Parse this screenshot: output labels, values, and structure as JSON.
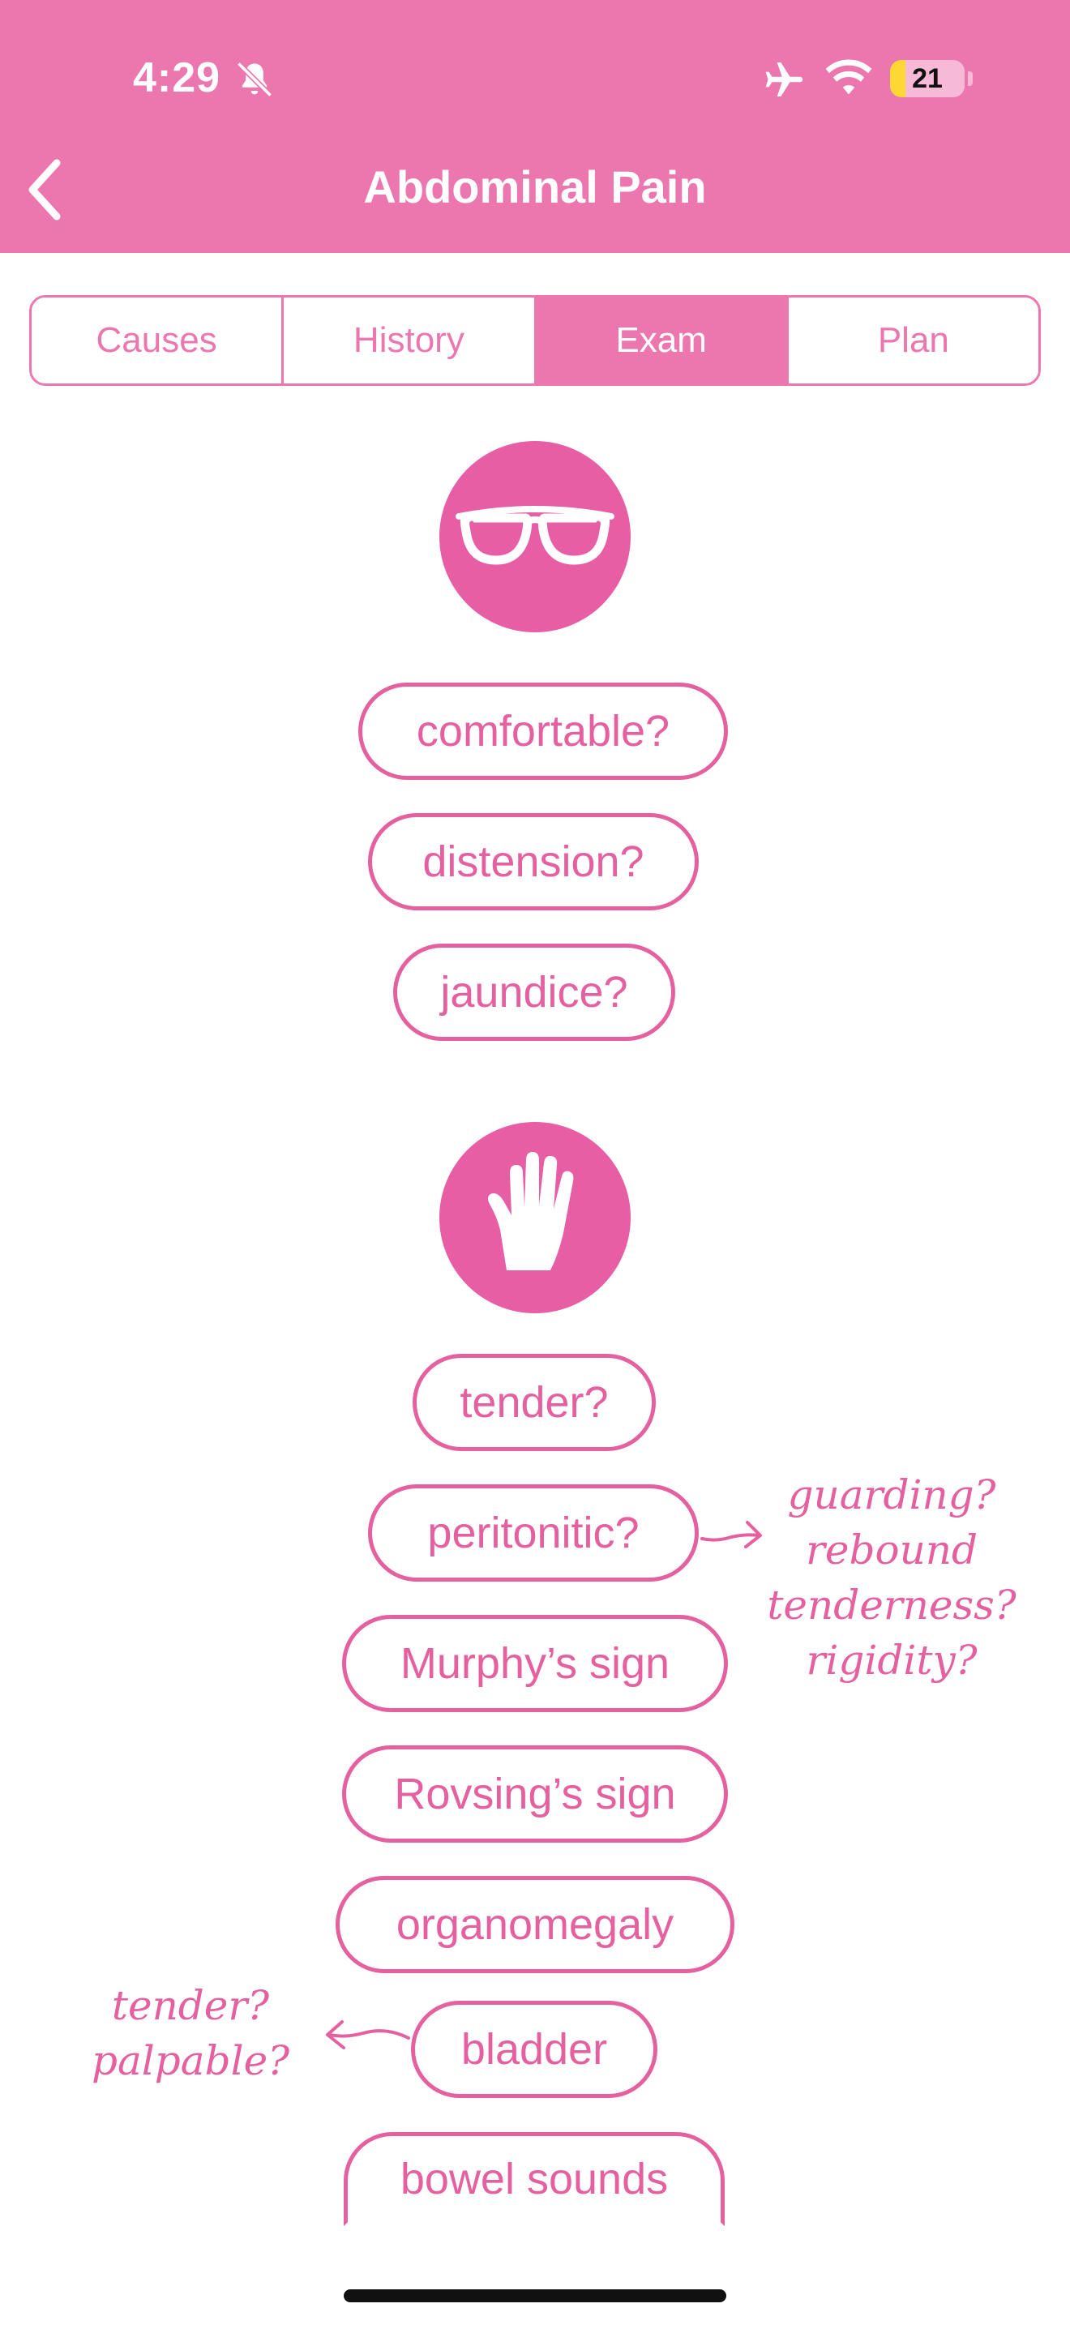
{
  "status_bar": {
    "time": "4:29",
    "battery": "21",
    "battery_level": 0.21
  },
  "header": {
    "title": "Abdominal Pain"
  },
  "tabs": [
    {
      "label": "Causes",
      "active": false
    },
    {
      "label": "History",
      "active": false
    },
    {
      "label": "Exam",
      "active": true
    },
    {
      "label": "Plan",
      "active": false
    }
  ],
  "sections": [
    {
      "icon": "glasses-icon",
      "items": [
        "comfortable?",
        "distension?",
        "jaundice?"
      ]
    },
    {
      "icon": "hand-icon",
      "items": [
        "tender?",
        "peritonitic?",
        "Murphy’s sign",
        "Rovsing’s sign",
        "organomegaly",
        "bladder",
        "bowel sounds"
      ]
    }
  ],
  "notes": {
    "peritonitic": [
      "guarding?",
      "rebound",
      "tenderness?",
      "rigidity?"
    ],
    "bladder": [
      "tender?",
      "palpable?"
    ]
  },
  "colors": {
    "header": "#ec77ae",
    "accent": "#e5609f",
    "icon_circle": "#e75ea5"
  }
}
